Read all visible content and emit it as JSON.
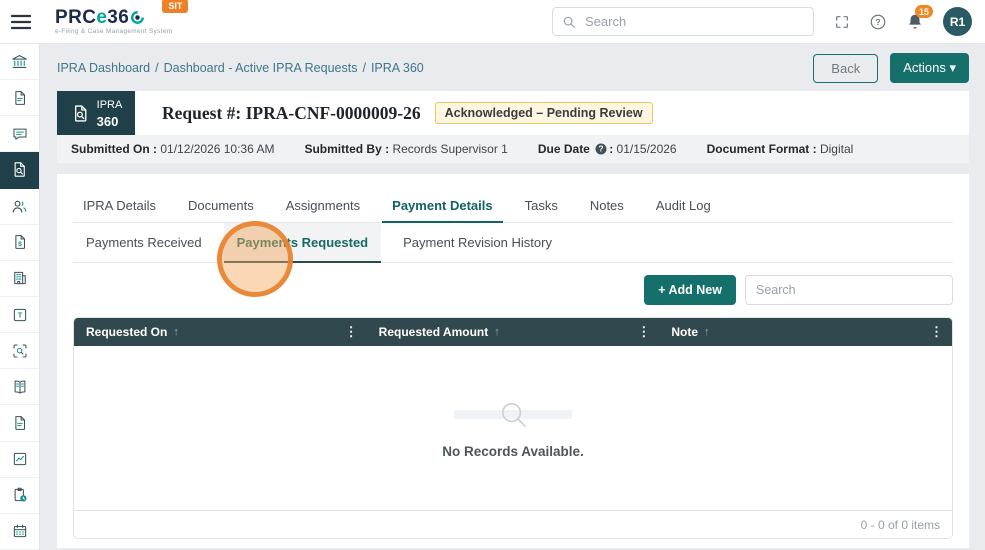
{
  "topbar": {
    "env_badge": "SIT",
    "logo": {
      "part1": "PRC",
      "part2": "e",
      "part3": "36",
      "tagline": "e-Filing & Case Management System"
    },
    "search": {
      "placeholder": "Search"
    },
    "notifications_count": "15",
    "avatar_initials": "R1"
  },
  "sidebar": {
    "items": [
      {
        "icon": "bank-icon",
        "active": false
      },
      {
        "icon": "document-icon",
        "active": false
      },
      {
        "icon": "chat-icon",
        "active": false
      },
      {
        "icon": "document-search-icon",
        "active": true
      },
      {
        "icon": "people-icon",
        "active": false
      },
      {
        "icon": "invoice-dollar-icon",
        "active": false
      },
      {
        "icon": "building-icon",
        "active": false
      },
      {
        "icon": "note-template-icon",
        "active": false
      },
      {
        "icon": "scan-search-icon",
        "active": false
      },
      {
        "icon": "ledger-icon",
        "active": false
      },
      {
        "icon": "document-lines-icon",
        "active": false
      },
      {
        "icon": "chart-icon",
        "active": false
      },
      {
        "icon": "clipboard-clock-icon",
        "active": false
      },
      {
        "icon": "calendar-icon",
        "active": false
      }
    ]
  },
  "breadcrumb": {
    "items": [
      "IPRA Dashboard",
      "Dashboard - Active IPRA Requests",
      "IPRA 360"
    ],
    "separator": "/"
  },
  "page_actions": {
    "back_label": "Back",
    "actions_label": "Actions",
    "actions_caret": "▾"
  },
  "request_header": {
    "badge_top": "IPRA",
    "badge_bottom": "360",
    "title_label": "Request #:",
    "title_value": "IPRA-CNF-0000009-26",
    "status_badge": "Acknowledged – Pending Review"
  },
  "meta": {
    "items": [
      {
        "label": "Submitted On",
        "value": "01/12/2026 10:36 AM",
        "help": false
      },
      {
        "label": "Submitted By",
        "value": "Records Supervisor 1",
        "help": false
      },
      {
        "label": "Due Date",
        "value": "01/15/2026",
        "help": true
      },
      {
        "label": "Document Format",
        "value": "Digital",
        "help": false
      }
    ]
  },
  "tabs": {
    "items": [
      "IPRA Details",
      "Documents",
      "Assignments",
      "Payment Details",
      "Tasks",
      "Notes",
      "Audit Log"
    ],
    "active": "Payment Details"
  },
  "subtabs": {
    "items": [
      "Payments Received",
      "Payments Requested",
      "Payment Revision History"
    ],
    "active": "Payments Requested"
  },
  "toolbar": {
    "add_new_label": "+ Add New",
    "search_placeholder": "Search"
  },
  "table": {
    "columns": [
      {
        "label": "Requested On",
        "sort": "asc"
      },
      {
        "label": "Requested Amount",
        "sort": "asc"
      },
      {
        "label": "Note",
        "sort": "asc"
      }
    ],
    "rows": [],
    "empty_message": "No Records Available.",
    "pagination_summary": "0 - 0 of 0 items"
  },
  "click_indicator": {
    "present": true,
    "target": "Payments Requested"
  },
  "colors": {
    "accent_teal": "#15706b",
    "dark_slate": "#1f4049",
    "table_header": "#31494e",
    "env_badge_orange": "#f08026",
    "status_bg": "#fdf7e2",
    "status_border": "#e5c75e",
    "click_indicator_orange": "#e6822c"
  }
}
